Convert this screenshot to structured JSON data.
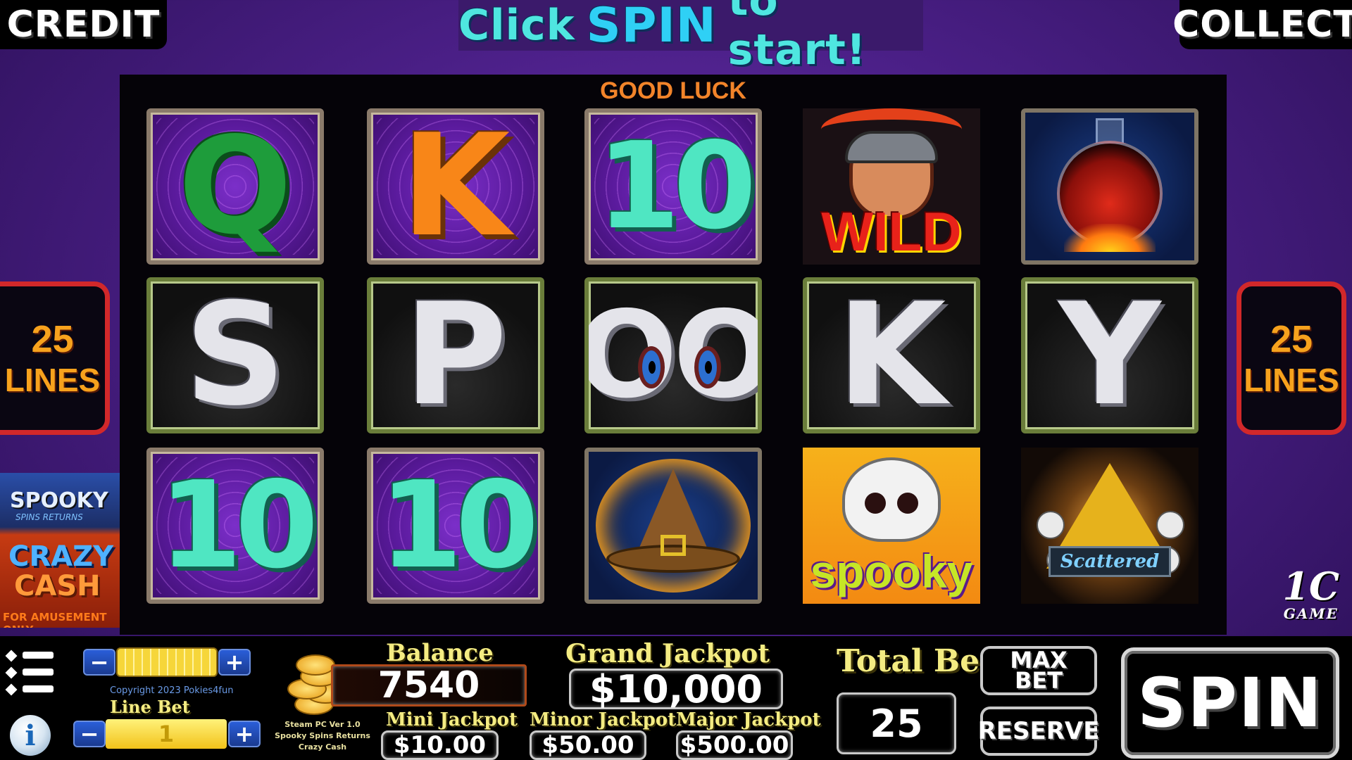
{
  "top": {
    "credit_label": "CREDIT",
    "collect_label": "COLLECT",
    "banner_pre": "Click",
    "banner_spin": "SPIN",
    "banner_post": "to start!"
  },
  "reels": {
    "good_luck": "GOOD LUCK",
    "row1": [
      "Q",
      "K",
      "10",
      "WILD",
      "potion"
    ],
    "row2": [
      "S",
      "P",
      "OO",
      "K",
      "Y"
    ],
    "row3": [
      "10",
      "10",
      "witch-hat",
      "spooky",
      "Scattered"
    ],
    "wild_text": "WILD",
    "spooky_text": "spooky",
    "scatter_text": "Scattered"
  },
  "lines": {
    "left_count": "25",
    "left_word": "LINES",
    "right_count": "25",
    "right_word": "LINES"
  },
  "logo": {
    "title": "SPOOKY",
    "subtitle": "SPINS RETURNS",
    "crazy": "CRAZY",
    "cash": "CASH",
    "amusement": "FOR AMUSEMENT ONLY"
  },
  "game_mark": {
    "top": "1C",
    "bottom": "GAME"
  },
  "controls": {
    "coin_minus": "−",
    "coin_plus": "+",
    "copyright": "Copyright 2023 Pokies4fun",
    "line_bet_label": "Line Bet",
    "line_bet_value": "1",
    "line_minus": "−",
    "line_plus": "+",
    "info_label": "i",
    "version_line1": "Steam PC Ver 1.0",
    "version_line2": "Spooky Spins Returns",
    "version_line3": "Crazy Cash",
    "balance_label": "Balance",
    "balance_value": "7540",
    "grand_label": "Grand Jackpot",
    "grand_value": "$10,000",
    "mini_label": "Mini Jackpot",
    "mini_value": "$10.00",
    "minor_label": "Minor Jackpot",
    "minor_value": "$50.00",
    "major_label": "Major Jackpot",
    "major_value": "$500.00",
    "total_bet_label": "Total Bet",
    "total_bet_value": "25",
    "max_bet_line1": "MAX",
    "max_bet_line2": "BET",
    "reserve_label": "RESERVE",
    "spin_label": "SPIN"
  },
  "colors": {
    "background": "#4a1f86",
    "banner_text": "#4fe6e0",
    "lines_border": "#d2282a",
    "lines_text": "#f7a21d",
    "label_yellow": "#f4ec82"
  }
}
